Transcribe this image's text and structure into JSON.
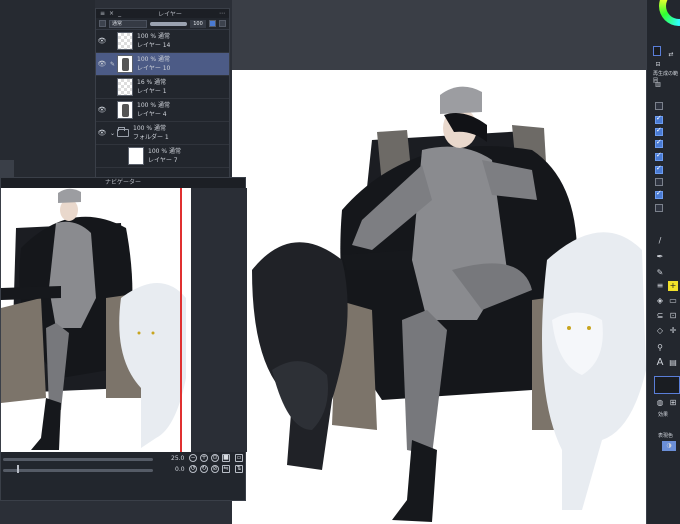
{
  "layer_panel": {
    "title": "レイヤー",
    "blend_mode": "通常",
    "opacity": "100",
    "layers": [
      {
        "percent": "100 % 通常",
        "name": "レイヤー 14"
      },
      {
        "percent": "100 % 通常",
        "name": "レイヤー 10"
      },
      {
        "percent": "16 % 通常",
        "name": "レイヤー 1"
      },
      {
        "percent": "100 % 通常",
        "name": "レイヤー 4"
      },
      {
        "percent": "100 % 通常",
        "name": "フォルダー 1"
      },
      {
        "percent": "100 % 通常",
        "name": "レイヤー 7"
      }
    ]
  },
  "navigator": {
    "title": "ナビゲーター",
    "zoom": "25.0",
    "rotation": "0.0"
  },
  "right_bar": {
    "label_top": "再生成の範囲",
    "effects_label": "効果",
    "expression_color_label": "表現色"
  },
  "colors": {
    "accent": "#4a7bd3",
    "selected_layer": "#4c5b86",
    "frame_red": "#e03030",
    "highlight_yellow": "#f2e12a"
  }
}
